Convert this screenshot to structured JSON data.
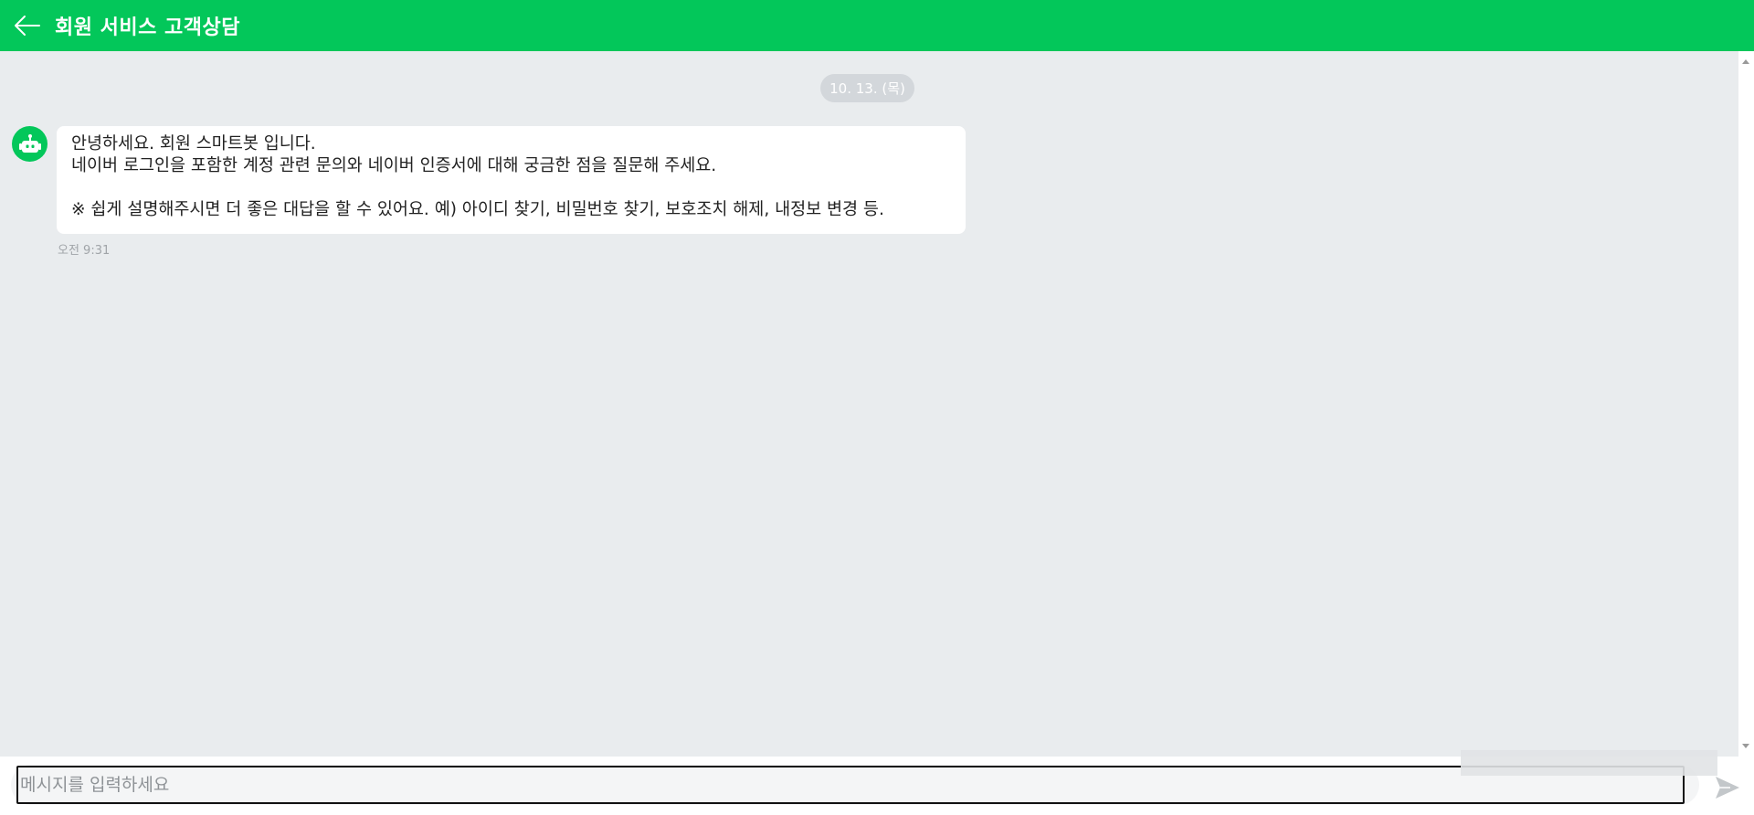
{
  "header": {
    "title": "회원 서비스 고객상담",
    "back_icon": "arrow-left-icon",
    "color": "#03c75a"
  },
  "chat": {
    "date_label": "10. 13. (목)",
    "bot_avatar_icon": "robot-icon",
    "messages": [
      {
        "sender": "bot",
        "lines": [
          "안녕하세요. 회원 스마트봇 입니다.",
          "네이버 로그인을 포함한 계정 관련 문의와 네이버 인증서에 대해 궁금한 점을 질문해 주세요.",
          "",
          "※ 쉽게 설명해주시면 더 좋은 대답을 할 수 있어요. 예) 아이디 찾기, 비밀번호 찾기, 보호조치 해제, 내정보 변경 등."
        ],
        "time": "오전 9:31"
      }
    ]
  },
  "composer": {
    "placeholder": "메시지를 입력하세요",
    "value": "",
    "send_icon": "send-icon"
  }
}
